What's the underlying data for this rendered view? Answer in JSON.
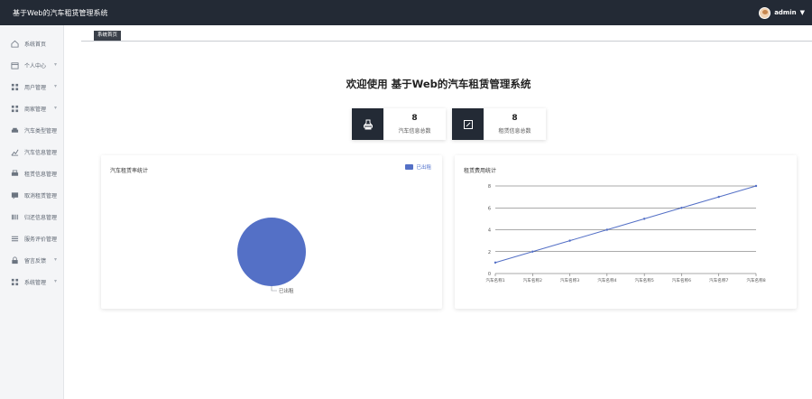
{
  "app_title": "基于Web的汽车租赁管理系统",
  "user": {
    "name": "admin"
  },
  "sidebar": {
    "items": [
      {
        "label": "系统首页",
        "icon": "home-icon",
        "has_submenu": false
      },
      {
        "label": "个人中心",
        "icon": "calendar-icon",
        "has_submenu": true
      },
      {
        "label": "用户管理",
        "icon": "grid-icon",
        "has_submenu": true
      },
      {
        "label": "商家管理",
        "icon": "grid-icon",
        "has_submenu": true
      },
      {
        "label": "汽车类型管理",
        "icon": "car-icon",
        "has_submenu": false
      },
      {
        "label": "汽车信息管理",
        "icon": "chart-icon",
        "has_submenu": false
      },
      {
        "label": "租赁信息管理",
        "icon": "printer-icon",
        "has_submenu": false
      },
      {
        "label": "取消租赁管理",
        "icon": "chat-icon",
        "has_submenu": false
      },
      {
        "label": "归还信息管理",
        "icon": "barcode-icon",
        "has_submenu": false
      },
      {
        "label": "服务评价管理",
        "icon": "list-icon",
        "has_submenu": false
      },
      {
        "label": "留言反馈",
        "icon": "lock-icon",
        "has_submenu": true
      },
      {
        "label": "系统管理",
        "icon": "grid-icon",
        "has_submenu": true
      }
    ]
  },
  "breadcrumb": "系统首页",
  "welcome": "欢迎使用 基于Web的汽车租赁管理系统",
  "stats": [
    {
      "value": "8",
      "label": "汽车信息总数",
      "icon": "stamp-icon"
    },
    {
      "value": "8",
      "label": "租赁信息总数",
      "icon": "edit-icon"
    }
  ],
  "chart_data": [
    {
      "type": "pie",
      "title": "汽车租赁率统计",
      "legend": [
        "已出租"
      ],
      "legend_position": "top-right",
      "slices": [
        {
          "name": "已出租",
          "value": 100
        }
      ],
      "color": "#5470c6"
    },
    {
      "type": "line",
      "title": "租赁费用统计",
      "categories": [
        "汽车名称1",
        "汽车名称2",
        "汽车名称3",
        "汽车名称4",
        "汽车名称5",
        "汽车名称6",
        "汽车名称7",
        "汽车名称8"
      ],
      "values": [
        1,
        2,
        3,
        4,
        5,
        6,
        7,
        8
      ],
      "ylim": [
        0,
        8
      ],
      "yticks": [
        0,
        2,
        4,
        6,
        8
      ],
      "grid": true,
      "color": "#5470c6"
    }
  ]
}
